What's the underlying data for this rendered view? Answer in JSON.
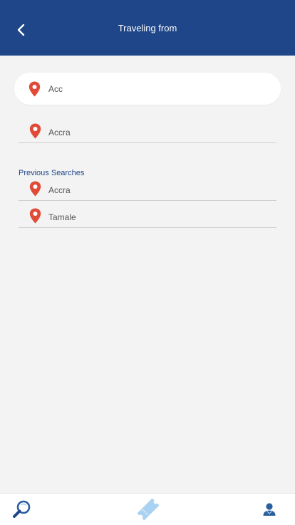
{
  "header": {
    "title": "Traveling from",
    "back_icon": "chevron-left-icon"
  },
  "search": {
    "value": "Acc",
    "icon": "map-pin-icon"
  },
  "suggestions": [
    {
      "label": "Accra"
    }
  ],
  "previous_searches": {
    "title": "Previous Searches",
    "items": [
      {
        "label": "Accra"
      },
      {
        "label": "Tamale"
      }
    ]
  },
  "bottom_nav": {
    "items": [
      {
        "icon": "search-icon"
      },
      {
        "icon": "ticket-icon"
      },
      {
        "icon": "user-icon"
      }
    ]
  },
  "colors": {
    "header_bg": "#1f4688",
    "pin_red": "#e04a36",
    "accent_blue": "#1f4688",
    "ticket_light_blue": "#a9d2f2",
    "background": "#f3f3f3"
  }
}
